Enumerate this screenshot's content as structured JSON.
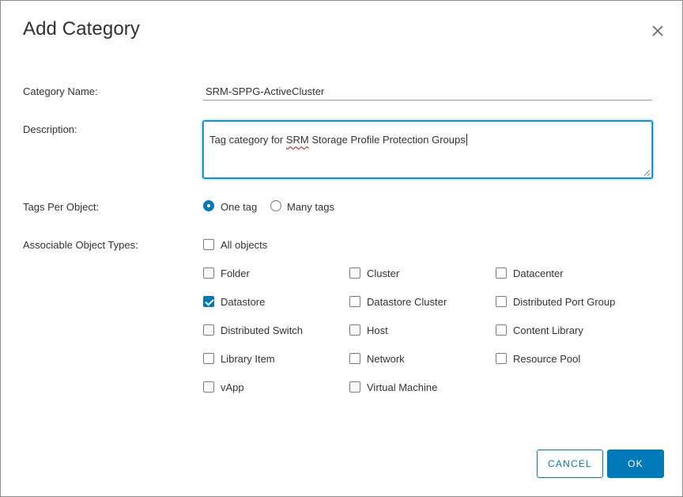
{
  "dialog": {
    "title": "Add Category",
    "close_icon": "close-icon"
  },
  "form": {
    "category_name": {
      "label": "Category Name:",
      "value": "SRM-SPPG-ActiveCluster"
    },
    "description": {
      "label": "Description:",
      "value_prefix": "Tag category for ",
      "value_spell": "SRM",
      "value_suffix": " Storage Profile Protection Groups"
    },
    "tags_per_object": {
      "label": "Tags Per Object:",
      "options": [
        {
          "label": "One tag",
          "selected": true
        },
        {
          "label": "Many tags",
          "selected": false
        }
      ]
    },
    "object_types": {
      "label": "Associable Object Types:",
      "all": {
        "label": "All objects",
        "checked": false
      },
      "items": [
        {
          "label": "Folder",
          "checked": false
        },
        {
          "label": "Cluster",
          "checked": false
        },
        {
          "label": "Datacenter",
          "checked": false
        },
        {
          "label": "Datastore",
          "checked": true
        },
        {
          "label": "Datastore Cluster",
          "checked": false
        },
        {
          "label": "Distributed Port Group",
          "checked": false
        },
        {
          "label": "Distributed Switch",
          "checked": false
        },
        {
          "label": "Host",
          "checked": false
        },
        {
          "label": "Content Library",
          "checked": false
        },
        {
          "label": "Library Item",
          "checked": false
        },
        {
          "label": "Network",
          "checked": false
        },
        {
          "label": "Resource Pool",
          "checked": false
        },
        {
          "label": "vApp",
          "checked": false
        },
        {
          "label": "Virtual Machine",
          "checked": false
        }
      ]
    }
  },
  "footer": {
    "cancel_label": "CANCEL",
    "ok_label": "OK"
  },
  "colors": {
    "accent": "#0079b8",
    "text": "#333333"
  }
}
